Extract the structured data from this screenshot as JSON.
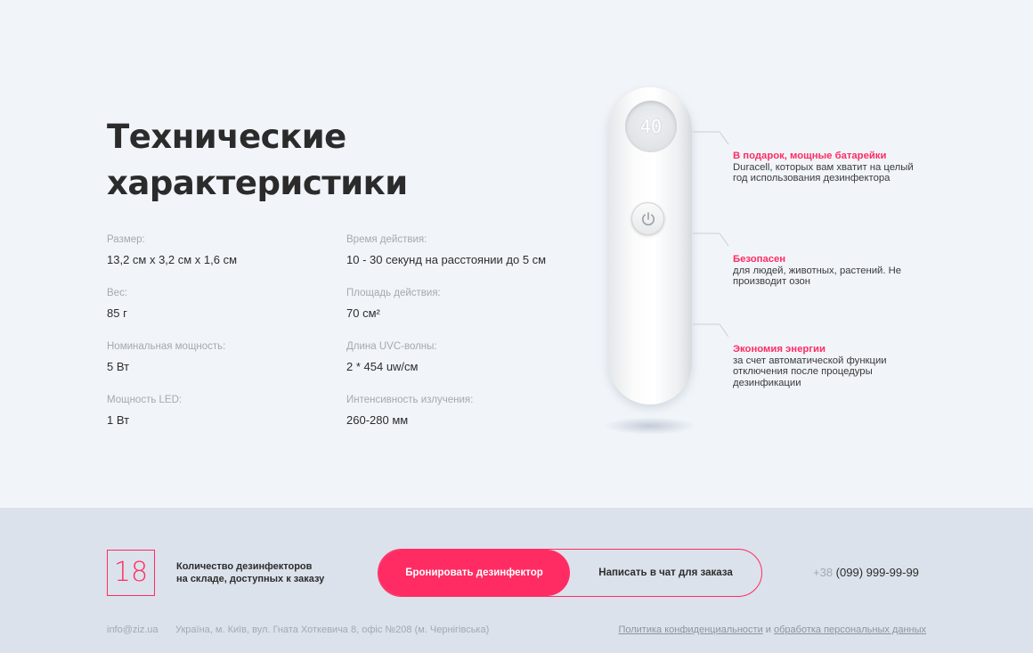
{
  "section": {
    "title_line1": "Технические",
    "title_line2": "характеристики"
  },
  "specs_left": [
    {
      "label": "Размер:",
      "value": "13,2 см х 3,2 см х 1,6 см"
    },
    {
      "label": "Вес:",
      "value": "85 г"
    },
    {
      "label": "Номинальная мощность:",
      "value": "5 Вт"
    },
    {
      "label": "Мощность LED:",
      "value": "1 Вт"
    }
  ],
  "specs_right": [
    {
      "label": "Время действия:",
      "value": "10 - 30 секунд на расстоянии до 5 см"
    },
    {
      "label": "Площадь действия:",
      "value": "70 см²"
    },
    {
      "label": "Длина UVC-волны:",
      "value": "2 * 454 uw/см"
    },
    {
      "label": "Интенсивность излучения:",
      "value": "260-280 мм"
    }
  ],
  "device": {
    "display_value": "40",
    "power_icon": "power-icon"
  },
  "callouts": [
    {
      "heading": "В подарок, мощные батарейки",
      "text": "Duracell, которых вам хватит на целый год использования дезинфектора"
    },
    {
      "heading": "Безопасен",
      "text": "для людей, животных, растений. Не производит озон"
    },
    {
      "heading": "Экономия энергии",
      "text": "за счет автоматической функции отключения после процедуры дезинфикации"
    }
  ],
  "footer": {
    "stock_count": "18",
    "stock_text_line1": "Количество дезинфекторов",
    "stock_text_line2": "на складе, доступных к заказу",
    "book_button": "Бронировать дезинфектор",
    "chat_button": "Написать в чат для заказа",
    "phone_code": "+38",
    "phone_number": " (099) 999-99-99",
    "email": "info@ziz.ua",
    "address": "Україна, м. Київ, вул. Гната Хоткевича 8, офіс №208 (м. Чернігівська)",
    "privacy_link": "Политика конфиденциальности",
    "and_text": " и ",
    "data_link": "обработка персональных данных"
  },
  "colors": {
    "accent": "#ff2c63",
    "background": "#f1f5fa",
    "footer_bg": "#dbe2eb",
    "muted": "#a4a9b0"
  }
}
